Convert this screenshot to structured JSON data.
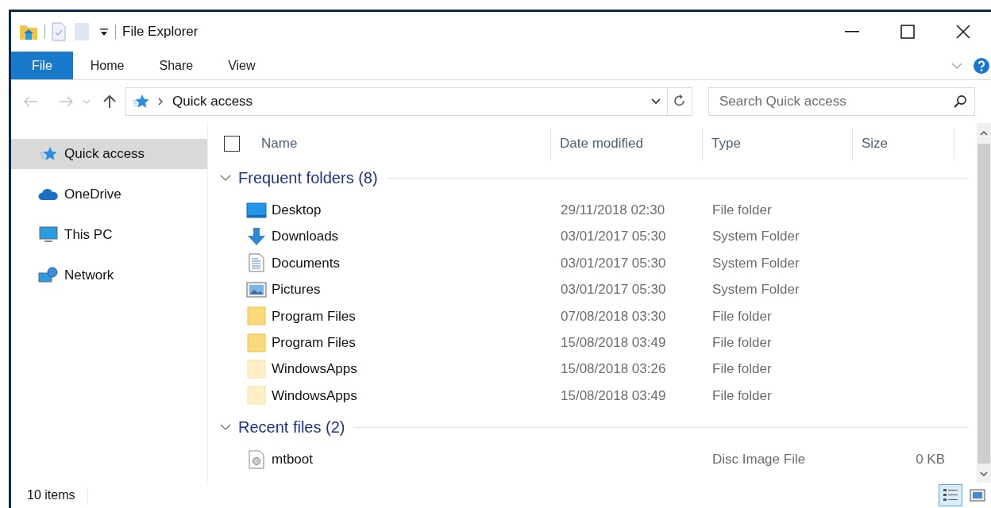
{
  "window": {
    "title": "File Explorer"
  },
  "ribbon_tabs": [
    {
      "label": "File",
      "selected": true
    },
    {
      "label": "Home",
      "selected": false
    },
    {
      "label": "Share",
      "selected": false
    },
    {
      "label": "View",
      "selected": false
    }
  ],
  "address": {
    "path": "Quick access"
  },
  "search": {
    "placeholder": "Search Quick access"
  },
  "sidebar": {
    "items": [
      {
        "label": "Quick access",
        "kind": "star",
        "selected": true
      },
      {
        "label": "OneDrive",
        "kind": "cloud",
        "selected": false
      },
      {
        "label": "This PC",
        "kind": "pc",
        "selected": false
      },
      {
        "label": "Network",
        "kind": "network",
        "selected": false
      }
    ]
  },
  "table": {
    "select_all": {
      "checked": false
    },
    "columns": [
      "Name",
      "Date modified",
      "Type",
      "Size"
    ],
    "groups": [
      {
        "title": "Frequent folders (8)",
        "expanded": true,
        "rows": [
          {
            "name": "Desktop",
            "kind": "desktop",
            "date": "29/11/2018 02:30",
            "type": "File folder"
          },
          {
            "name": "Downloads",
            "kind": "downloads",
            "date": "03/01/2017 05:30",
            "type": "System Folder"
          },
          {
            "name": "Documents",
            "kind": "documents",
            "date": "03/01/2017 05:30",
            "type": "System Folder"
          },
          {
            "name": "Pictures",
            "kind": "pictures",
            "date": "03/01/2017 05:30",
            "type": "System Folder"
          },
          {
            "name": "Program Files",
            "kind": "folder",
            "date": "07/08/2018 03:30",
            "type": "File folder"
          },
          {
            "name": "Program Files",
            "kind": "folder",
            "date": "15/08/2018 03:49",
            "type": "File folder"
          },
          {
            "name": "WindowsApps",
            "kind": "folder-light",
            "date": "15/08/2018 03:26",
            "type": "File folder"
          },
          {
            "name": "WindowsApps",
            "kind": "folder-light",
            "date": "15/08/2018 03:49",
            "type": "File folder"
          }
        ]
      },
      {
        "title": "Recent files (2)",
        "expanded": true,
        "rows": [
          {
            "name": "mtboot",
            "kind": "disc",
            "type": "Disc Image File",
            "size": "0 KB"
          }
        ]
      }
    ]
  },
  "status_bar": {
    "count": "10 items",
    "views": [
      {
        "kind": "details",
        "selected": true
      },
      {
        "kind": "large-icons",
        "selected": false
      }
    ]
  }
}
